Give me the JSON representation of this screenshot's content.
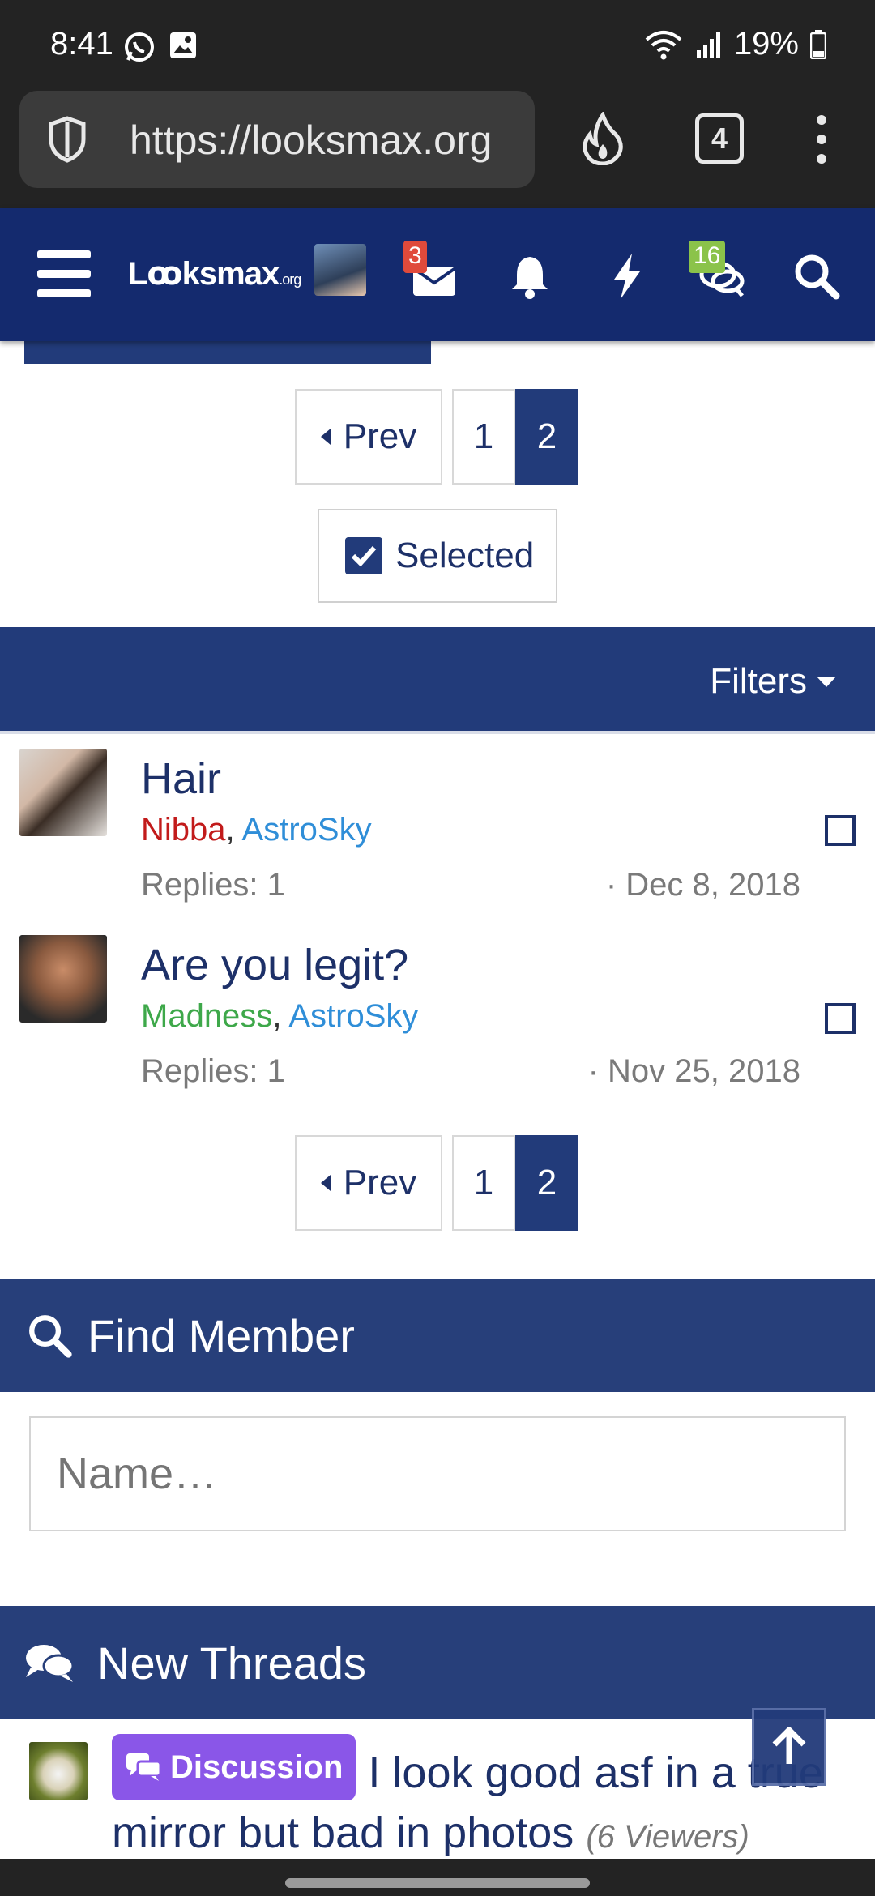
{
  "status_bar": {
    "time": "8:41",
    "battery": "19%"
  },
  "browser": {
    "url": "https://looksmax.org",
    "tab_count": "4"
  },
  "site_header": {
    "logo_text": "Lꝏksmax",
    "logo_suffix": ".org",
    "messages_badge": "3",
    "alerts_badge": "16",
    "colors": {
      "header": "#142a6e",
      "messages_badge": "#e04a3b",
      "alerts_badge": "#8bc34a"
    }
  },
  "pagination": {
    "prev_label": "Prev",
    "pages": [
      "1",
      "2"
    ],
    "current_page": "2"
  },
  "selected_button": {
    "label": "Selected"
  },
  "filters": {
    "label": "Filters"
  },
  "threads": [
    {
      "title": "Hair",
      "user1": "Nibba",
      "user2": "AstroSky",
      "replies": "Replies: 1",
      "date": "· Dec 8, 2018"
    },
    {
      "title": "Are you legit?",
      "user1": "Madness",
      "user2": "AstroSky",
      "replies": "Replies: 1",
      "date": "· Nov 25, 2018"
    }
  ],
  "find_member": {
    "title": "Find Member",
    "placeholder": "Name…"
  },
  "new_threads": {
    "title": "New Threads",
    "items": [
      {
        "prefix": "Discussion",
        "title": "I look good asf in a true mirror but bad in photos",
        "viewers": "(6 Viewers)"
      }
    ]
  }
}
